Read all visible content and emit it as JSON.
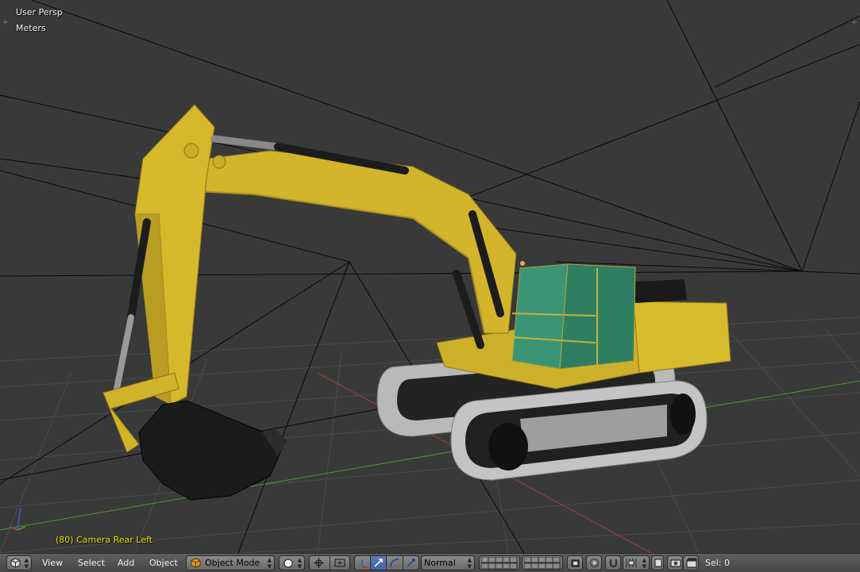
{
  "viewport": {
    "view_name": "User Persp",
    "units": "Meters",
    "camera_label": "(80) Camera Rear Left"
  },
  "header": {
    "menus": [
      "View",
      "Select",
      "Add",
      "Object"
    ],
    "mode": "Object Mode",
    "orientation": "Normal",
    "status": "Sel: 0"
  },
  "icons": {
    "editor_type": "cube-icon",
    "mode": "orange-cube-icon",
    "shading": "solid-sphere-icon",
    "pivot": "pivot-icon",
    "manipulator": "manipulator-icon",
    "snap": "magnet-icon",
    "render": "camera-icon"
  },
  "colors": {
    "viewport_bg": "#393939",
    "header_bg": "#4f4f4f",
    "body_yellow": "#d7b92a",
    "cab_green": "#2f8a6a",
    "track_grey": "#b8b8b8",
    "x_axis": "#a33b3b",
    "y_axis": "#4e9a2c",
    "camera_label": "#e4e100",
    "active_button": "#5677b8"
  }
}
